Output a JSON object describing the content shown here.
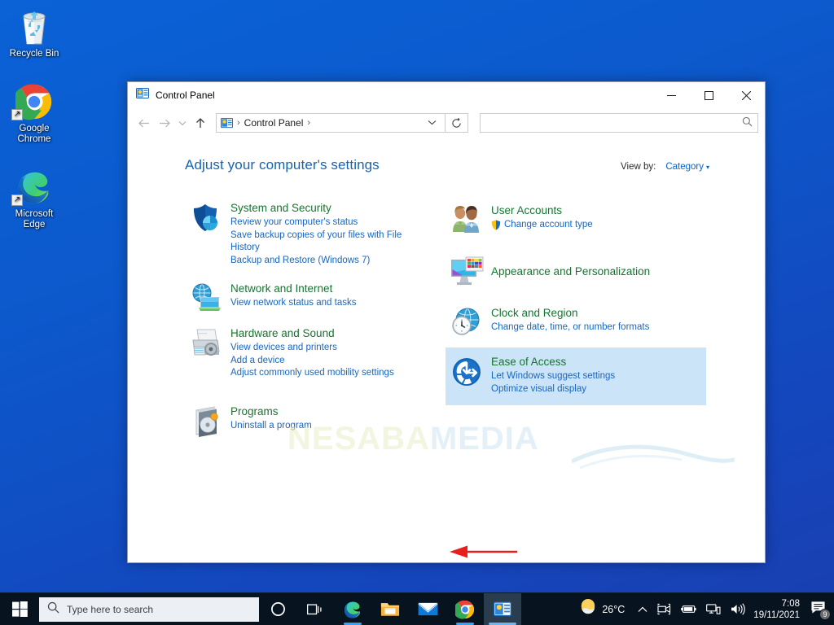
{
  "desktop": {
    "icons": [
      {
        "name": "Recycle Bin",
        "icon": "recycle-bin-icon",
        "shortcut": false
      },
      {
        "name": "Google\nChrome",
        "label_lines": [
          "Google",
          "Chrome"
        ],
        "icon": "chrome-icon",
        "shortcut": true
      },
      {
        "name": "Microsoft\nEdge",
        "label_lines": [
          "Microsoft",
          "Edge"
        ],
        "icon": "edge-icon",
        "shortcut": true
      }
    ]
  },
  "window": {
    "title": "Control Panel",
    "title_icon": "control-panel-icon",
    "controls": {
      "minimize": "—",
      "maximize": "☐",
      "close": "✕"
    },
    "nav": {
      "back": "←",
      "forward": "→",
      "recent": "⌄",
      "up": "↑",
      "refresh": "↻",
      "chevron": "⌄"
    },
    "breadcrumb": {
      "icon": "control-panel-icon",
      "items": [
        "Control Panel"
      ],
      "separator": "›"
    },
    "search": {
      "value": "",
      "placeholder": "",
      "icon": "search-icon"
    }
  },
  "content": {
    "heading": "Adjust your computer's settings",
    "view_by": {
      "label": "View by:",
      "value": "Category",
      "caret": "▾"
    },
    "watermark": {
      "part1": "NESABA",
      "part2": "MEDIA"
    },
    "annotation": {
      "type": "red-arrow",
      "color": "#e8201c",
      "points_to": "Uninstall a program"
    },
    "left_column": [
      {
        "title": "System and Security",
        "icon": "shield-security-icon",
        "links": [
          "Review your computer's status",
          "Save backup copies of your files with File History",
          "Backup and Restore (Windows 7)"
        ]
      },
      {
        "title": "Network and Internet",
        "icon": "network-globe-icon",
        "links": [
          "View network status and tasks"
        ]
      },
      {
        "title": "Hardware and Sound",
        "icon": "printer-icon",
        "links": [
          "View devices and printers",
          "Add a device",
          "Adjust commonly used mobility settings"
        ]
      },
      {
        "title": "Programs",
        "icon": "programs-cd-icon",
        "links": [
          "Uninstall a program"
        ]
      }
    ],
    "right_column": [
      {
        "title": "User Accounts",
        "icon": "user-accounts-icon",
        "links": [
          "Change account type"
        ],
        "link_shield": true,
        "highlighted": false
      },
      {
        "title": "Appearance and Personalization",
        "icon": "appearance-monitor-icon",
        "links": [],
        "highlighted": false
      },
      {
        "title": "Clock and Region",
        "icon": "clock-region-icon",
        "links": [
          "Change date, time, or number formats"
        ],
        "highlighted": false
      },
      {
        "title": "Ease of Access",
        "icon": "ease-of-access-icon",
        "links": [
          "Let Windows suggest settings",
          "Optimize visual display"
        ],
        "highlighted": true
      }
    ]
  },
  "taskbar": {
    "start": "start-button",
    "search": {
      "placeholder": "Type here to search",
      "icon": "search-icon"
    },
    "buttons": [
      {
        "name": "cortana-button",
        "icon": "cortana-circle-icon",
        "active": false,
        "open": false
      },
      {
        "name": "task-view-button",
        "icon": "task-view-icon",
        "active": false,
        "open": false
      },
      {
        "name": "edge-taskbar-button",
        "icon": "edge-icon",
        "active": false,
        "open": true
      },
      {
        "name": "file-explorer-button",
        "icon": "folder-icon",
        "active": false,
        "open": false
      },
      {
        "name": "mail-button",
        "icon": "mail-envelope-icon",
        "active": false,
        "open": false
      },
      {
        "name": "chrome-taskbar-button",
        "icon": "chrome-icon",
        "active": false,
        "open": true
      },
      {
        "name": "control-panel-taskbar-button",
        "icon": "control-panel-icon",
        "active": true,
        "open": true
      }
    ],
    "tray": {
      "weather": {
        "temp": "26°C",
        "icon": "weather-sun-cloud-icon"
      },
      "chevron": "⌃",
      "icons": [
        "meet-now-icon",
        "battery-icon",
        "network-icon",
        "volume-icon"
      ],
      "clock": {
        "time": "7:08",
        "date": "19/11/2021"
      },
      "notifications": {
        "icon": "action-center-icon",
        "count": "9"
      }
    }
  },
  "colors": {
    "accent_blue": "#0a60c8",
    "link_blue": "#1866c0",
    "category_green": "#15752f",
    "heading_blue": "#1464b4",
    "highlight": "#cce4f7",
    "annotation_red": "#e8201c",
    "taskbar": "#07131f"
  }
}
